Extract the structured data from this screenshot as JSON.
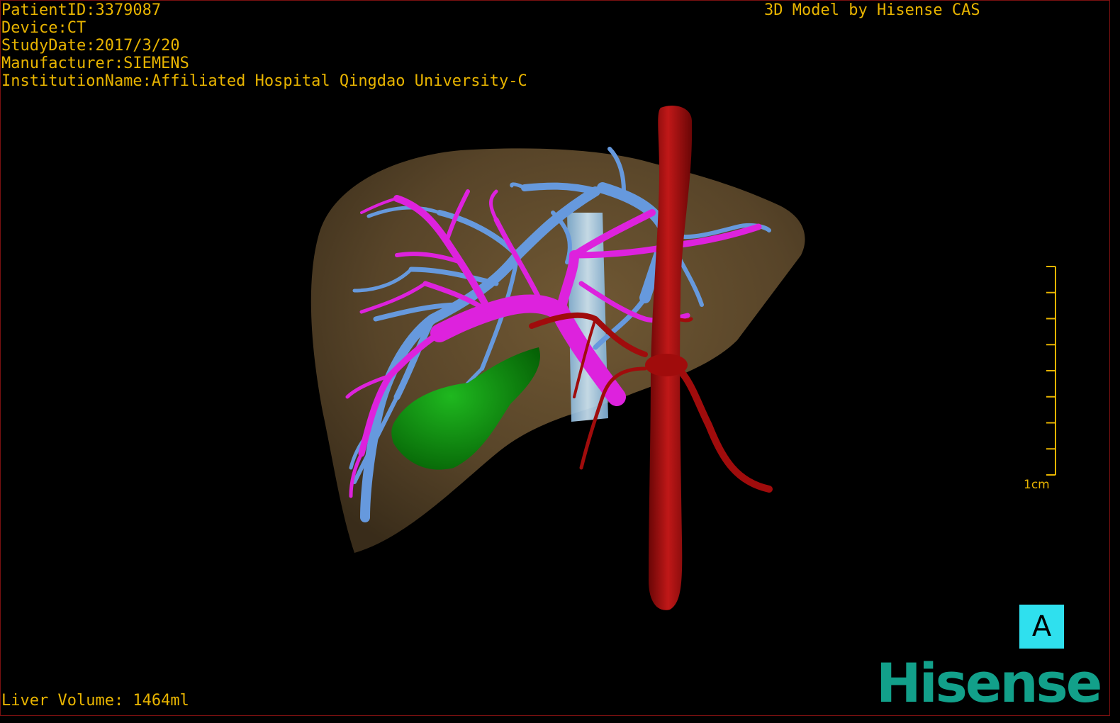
{
  "patient_info": {
    "patient_id": "PatientID:3379087",
    "device": "Device:CT",
    "study_date": "StudyDate:2017/3/20",
    "manufacturer": "Manufacturer:SIEMENS",
    "institution": "InstitutionName:Affiliated Hospital Qingdao University-C"
  },
  "credit": "3D Model by Hisense CAS",
  "liver_volume": "Liver Volume: 1464ml",
  "scale": {
    "label": "1cm",
    "ticks": 9
  },
  "view_badge": "A",
  "logo": "Hisense",
  "colors": {
    "text": "#e8b400",
    "liver": "#6b5331",
    "portal_vein": "#dd22dd",
    "hepatic_vein": "#6699dd",
    "vena_cava": "#a8d4f0",
    "artery": "#b01010",
    "gallbladder": "#0a8a0a",
    "badge": "#2fe0ee",
    "logo": "#12a08a"
  }
}
